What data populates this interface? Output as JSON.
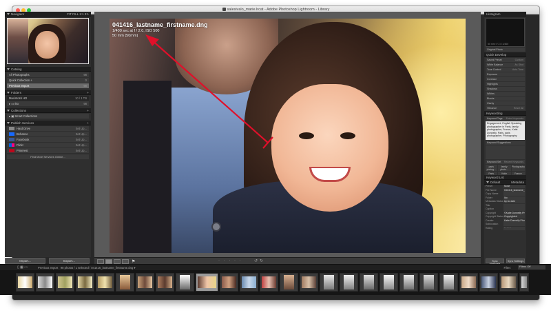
{
  "window": {
    "title": "salesivalo_marie.lrcat - Adobe Photoshop Lightroom - Library"
  },
  "navigator": {
    "label": "Navigator",
    "zoom_options": [
      "FIT",
      "FILL",
      "1:1",
      "3:1"
    ]
  },
  "catalog": {
    "label": "Catalog",
    "items": [
      {
        "label": "All Photographs",
        "count": "98"
      },
      {
        "label": "Quick Collection +",
        "count": "0"
      },
      {
        "label": "Previous Import",
        "count": "98"
      }
    ]
  },
  "folders": {
    "label": "Folders",
    "items": [
      {
        "label": "Macintosh HD",
        "count": "10 / 1 TB"
      },
      {
        "label": "Iko",
        "count": "98"
      }
    ]
  },
  "collections": {
    "label": "Collections",
    "items": [
      {
        "label": "Smart Collections",
        "count": ""
      }
    ]
  },
  "publish": {
    "label": "Publish Services",
    "items": [
      {
        "label": "Hard Drive",
        "action": "Set Up..."
      },
      {
        "label": "Behance",
        "action": "Set Up..."
      },
      {
        "label": "Facebook",
        "action": "Set Up..."
      },
      {
        "label": "Flickr",
        "action": "Set Up..."
      },
      {
        "label": "Pinterest",
        "action": "Set Up..."
      }
    ],
    "find_more": "Find More Services Online..."
  },
  "buttons": {
    "import": "Import...",
    "export": "Export...",
    "sync_metadata": "Sync Metadata",
    "sync_settings": "Sync Settings"
  },
  "photo": {
    "filename": "041416_lastname_firstname.dng",
    "exposure": "1/400 sec at f / 2.0, ISO 500",
    "lens": "50 mm (50mm)"
  },
  "filmstrip": {
    "source": "Previous Import",
    "summary": "98 photos / 1 selected / 041416_lastname_firstname.dng",
    "filter_label": "Filter:",
    "filter_value": "Filters Off"
  },
  "right_panel": {
    "histogram": {
      "label": "Histogram",
      "info": "50 mm   f / 2.0   1/400",
      "original": "Original Photo"
    },
    "quick_develop": {
      "label": "Quick Develop",
      "saved_preset": "Saved Preset",
      "preset_value": "Custom",
      "white_balance": "White Balance",
      "wb_value": "As Shot",
      "tone_control": "Tone Control",
      "auto_tone": "Auto Tone",
      "rows": [
        "Exposure",
        "Contrast",
        "Highlights",
        "Shadows",
        "Whites",
        "Blacks",
        "Clarity",
        "Vibrance"
      ],
      "reset": "Reset All"
    },
    "keywording": {
      "label": "Keywording",
      "tags_label": "Keyword Tags",
      "tags_mode": "Enter Keywords",
      "tags_text": "Engagement, English Speaking photographer in Paris, family photographer, France, Katie Donnelly, Paris, paris photographer, Photography",
      "suggestions_label": "Keyword Suggestions",
      "set_label": "Keyword Set",
      "set_value": "Recent Keywords",
      "set_items": [
        "paris photog...",
        "family photo...",
        "Photography",
        "Paris",
        "Katie Donnelly",
        "France",
        "English Spea...",
        "Engagement",
        ""
      ]
    },
    "keyword_list": {
      "label": "Keyword List"
    },
    "metadata": {
      "label": "Metadata",
      "preset_label": "Preset",
      "preset_value": "None",
      "default_label": "Default",
      "fields": [
        {
          "label": "File Name",
          "value": "041416_lastname_firstname.dng"
        },
        {
          "label": "Copy Name",
          "value": ""
        },
        {
          "label": "Folder",
          "value": "Iko"
        },
        {
          "label": "Metadata Status",
          "value": "Up to date"
        },
        {
          "label": "Title",
          "value": ""
        },
        {
          "label": "Caption",
          "value": ""
        },
        {
          "label": "Copyright",
          "value": "©Katie Donnelly Photography"
        },
        {
          "label": "Copyright Status",
          "value": "Copyrighted"
        },
        {
          "label": "Creator",
          "value": "Katie Donnelly Photography"
        },
        {
          "label": "Sublocation",
          "value": ""
        },
        {
          "label": "Rating",
          "value": "· · · · ·"
        }
      ]
    }
  },
  "colors": {
    "arrow": "#e0102a",
    "panel": "#2f2f2f",
    "selected_row": "#6b6b6b"
  }
}
